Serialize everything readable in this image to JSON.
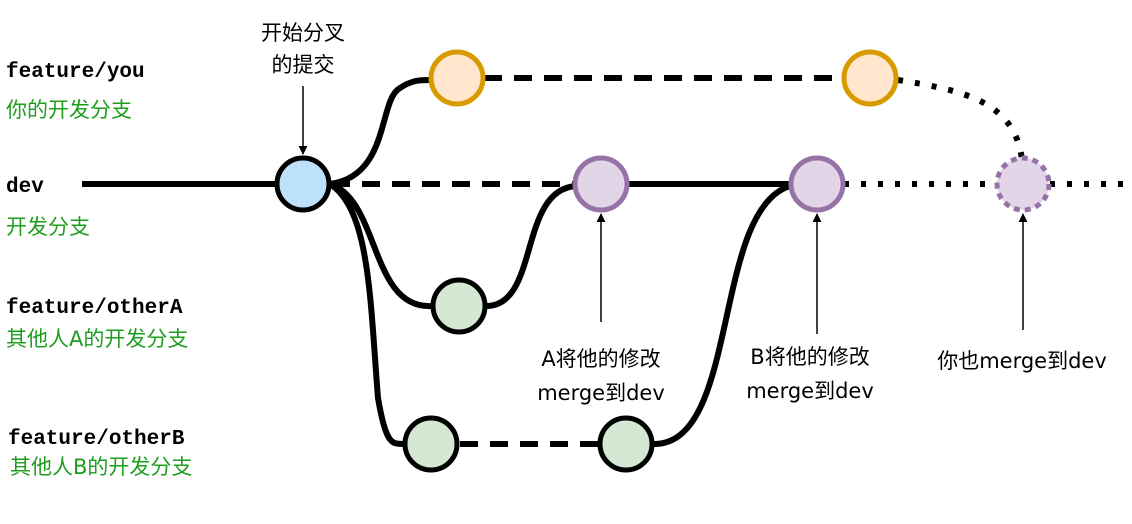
{
  "branches": {
    "feature_you": {
      "name": "feature/you",
      "desc": "你的开发分支"
    },
    "dev": {
      "name": "dev",
      "desc": "开发分支"
    },
    "feature_otherA": {
      "name": "feature/otherA",
      "desc": "其他人A的开发分支"
    },
    "feature_otherB": {
      "name": "feature/otherB",
      "desc": "其他人B的开发分支"
    }
  },
  "annotations": {
    "fork_commit": [
      "开始分叉",
      "的提交"
    ],
    "merge_a": [
      "A将他的修改",
      "merge到dev"
    ],
    "merge_b": [
      "B将他的修改",
      "merge到dev"
    ],
    "merge_you": "你也merge到dev"
  },
  "colors": {
    "desc_text": "#1f9d1f",
    "fork_commit_fill": "#bde0fb",
    "you_commit_fill": "#ffe6cc",
    "you_commit_stroke": "#d79b00",
    "merge_commit_fill": "#e1d5e7",
    "merge_commit_stroke": "#9673a6",
    "other_commit_fill": "#d5e8d4"
  }
}
